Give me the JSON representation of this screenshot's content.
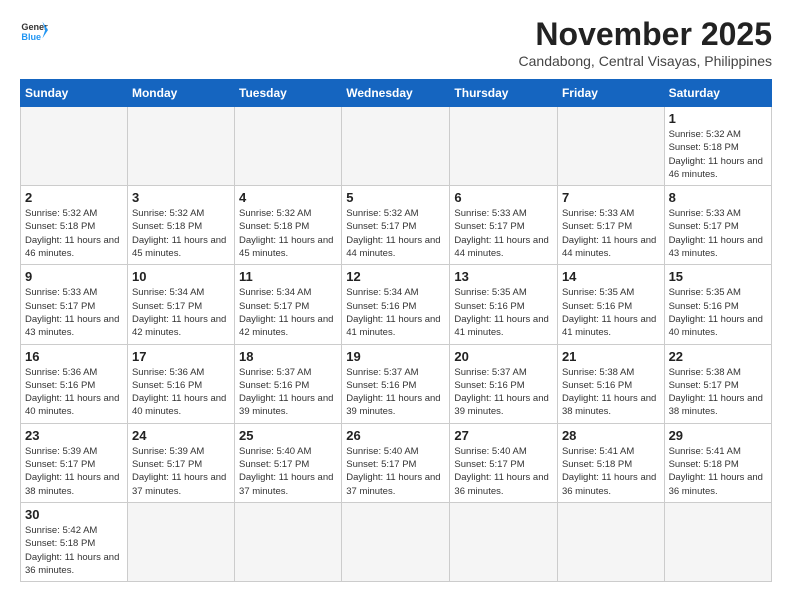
{
  "header": {
    "logo_general": "General",
    "logo_blue": "Blue",
    "month": "November 2025",
    "location": "Candabong, Central Visayas, Philippines"
  },
  "days_of_week": [
    "Sunday",
    "Monday",
    "Tuesday",
    "Wednesday",
    "Thursday",
    "Friday",
    "Saturday"
  ],
  "weeks": [
    [
      {
        "day": null
      },
      {
        "day": null
      },
      {
        "day": null
      },
      {
        "day": null
      },
      {
        "day": null
      },
      {
        "day": null
      },
      {
        "day": 1,
        "sunrise": "Sunrise: 5:32 AM",
        "sunset": "Sunset: 5:18 PM",
        "daylight": "Daylight: 11 hours and 46 minutes."
      }
    ],
    [
      {
        "day": 2,
        "sunrise": "Sunrise: 5:32 AM",
        "sunset": "Sunset: 5:18 PM",
        "daylight": "Daylight: 11 hours and 46 minutes."
      },
      {
        "day": 3,
        "sunrise": "Sunrise: 5:32 AM",
        "sunset": "Sunset: 5:18 PM",
        "daylight": "Daylight: 11 hours and 45 minutes."
      },
      {
        "day": 4,
        "sunrise": "Sunrise: 5:32 AM",
        "sunset": "Sunset: 5:18 PM",
        "daylight": "Daylight: 11 hours and 45 minutes."
      },
      {
        "day": 5,
        "sunrise": "Sunrise: 5:32 AM",
        "sunset": "Sunset: 5:17 PM",
        "daylight": "Daylight: 11 hours and 44 minutes."
      },
      {
        "day": 6,
        "sunrise": "Sunrise: 5:33 AM",
        "sunset": "Sunset: 5:17 PM",
        "daylight": "Daylight: 11 hours and 44 minutes."
      },
      {
        "day": 7,
        "sunrise": "Sunrise: 5:33 AM",
        "sunset": "Sunset: 5:17 PM",
        "daylight": "Daylight: 11 hours and 44 minutes."
      },
      {
        "day": 8,
        "sunrise": "Sunrise: 5:33 AM",
        "sunset": "Sunset: 5:17 PM",
        "daylight": "Daylight: 11 hours and 43 minutes."
      }
    ],
    [
      {
        "day": 9,
        "sunrise": "Sunrise: 5:33 AM",
        "sunset": "Sunset: 5:17 PM",
        "daylight": "Daylight: 11 hours and 43 minutes."
      },
      {
        "day": 10,
        "sunrise": "Sunrise: 5:34 AM",
        "sunset": "Sunset: 5:17 PM",
        "daylight": "Daylight: 11 hours and 42 minutes."
      },
      {
        "day": 11,
        "sunrise": "Sunrise: 5:34 AM",
        "sunset": "Sunset: 5:17 PM",
        "daylight": "Daylight: 11 hours and 42 minutes."
      },
      {
        "day": 12,
        "sunrise": "Sunrise: 5:34 AM",
        "sunset": "Sunset: 5:16 PM",
        "daylight": "Daylight: 11 hours and 41 minutes."
      },
      {
        "day": 13,
        "sunrise": "Sunrise: 5:35 AM",
        "sunset": "Sunset: 5:16 PM",
        "daylight": "Daylight: 11 hours and 41 minutes."
      },
      {
        "day": 14,
        "sunrise": "Sunrise: 5:35 AM",
        "sunset": "Sunset: 5:16 PM",
        "daylight": "Daylight: 11 hours and 41 minutes."
      },
      {
        "day": 15,
        "sunrise": "Sunrise: 5:35 AM",
        "sunset": "Sunset: 5:16 PM",
        "daylight": "Daylight: 11 hours and 40 minutes."
      }
    ],
    [
      {
        "day": 16,
        "sunrise": "Sunrise: 5:36 AM",
        "sunset": "Sunset: 5:16 PM",
        "daylight": "Daylight: 11 hours and 40 minutes."
      },
      {
        "day": 17,
        "sunrise": "Sunrise: 5:36 AM",
        "sunset": "Sunset: 5:16 PM",
        "daylight": "Daylight: 11 hours and 40 minutes."
      },
      {
        "day": 18,
        "sunrise": "Sunrise: 5:37 AM",
        "sunset": "Sunset: 5:16 PM",
        "daylight": "Daylight: 11 hours and 39 minutes."
      },
      {
        "day": 19,
        "sunrise": "Sunrise: 5:37 AM",
        "sunset": "Sunset: 5:16 PM",
        "daylight": "Daylight: 11 hours and 39 minutes."
      },
      {
        "day": 20,
        "sunrise": "Sunrise: 5:37 AM",
        "sunset": "Sunset: 5:16 PM",
        "daylight": "Daylight: 11 hours and 39 minutes."
      },
      {
        "day": 21,
        "sunrise": "Sunrise: 5:38 AM",
        "sunset": "Sunset: 5:16 PM",
        "daylight": "Daylight: 11 hours and 38 minutes."
      },
      {
        "day": 22,
        "sunrise": "Sunrise: 5:38 AM",
        "sunset": "Sunset: 5:17 PM",
        "daylight": "Daylight: 11 hours and 38 minutes."
      }
    ],
    [
      {
        "day": 23,
        "sunrise": "Sunrise: 5:39 AM",
        "sunset": "Sunset: 5:17 PM",
        "daylight": "Daylight: 11 hours and 38 minutes."
      },
      {
        "day": 24,
        "sunrise": "Sunrise: 5:39 AM",
        "sunset": "Sunset: 5:17 PM",
        "daylight": "Daylight: 11 hours and 37 minutes."
      },
      {
        "day": 25,
        "sunrise": "Sunrise: 5:40 AM",
        "sunset": "Sunset: 5:17 PM",
        "daylight": "Daylight: 11 hours and 37 minutes."
      },
      {
        "day": 26,
        "sunrise": "Sunrise: 5:40 AM",
        "sunset": "Sunset: 5:17 PM",
        "daylight": "Daylight: 11 hours and 37 minutes."
      },
      {
        "day": 27,
        "sunrise": "Sunrise: 5:40 AM",
        "sunset": "Sunset: 5:17 PM",
        "daylight": "Daylight: 11 hours and 36 minutes."
      },
      {
        "day": 28,
        "sunrise": "Sunrise: 5:41 AM",
        "sunset": "Sunset: 5:18 PM",
        "daylight": "Daylight: 11 hours and 36 minutes."
      },
      {
        "day": 29,
        "sunrise": "Sunrise: 5:41 AM",
        "sunset": "Sunset: 5:18 PM",
        "daylight": "Daylight: 11 hours and 36 minutes."
      }
    ],
    [
      {
        "day": 30,
        "sunrise": "Sunrise: 5:42 AM",
        "sunset": "Sunset: 5:18 PM",
        "daylight": "Daylight: 11 hours and 36 minutes."
      },
      {
        "day": null
      },
      {
        "day": null
      },
      {
        "day": null
      },
      {
        "day": null
      },
      {
        "day": null
      },
      {
        "day": null
      }
    ]
  ]
}
